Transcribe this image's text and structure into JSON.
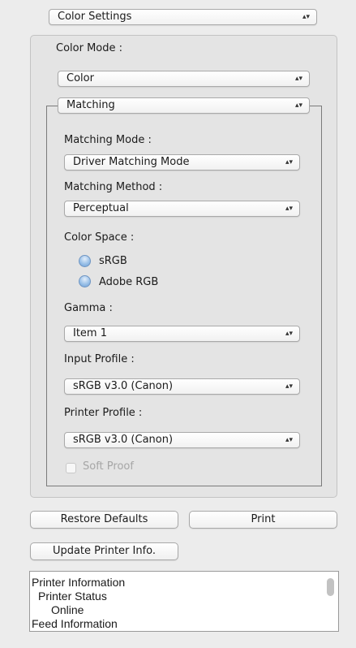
{
  "top_popup": {
    "value": "Color Settings"
  },
  "color_mode": {
    "label": "Color Mode :",
    "value": "Color"
  },
  "matching_group": {
    "header_value": "Matching",
    "matching_mode": {
      "label": "Matching Mode :",
      "value": "Driver Matching Mode"
    },
    "matching_method": {
      "label": "Matching Method :",
      "value": "Perceptual"
    },
    "color_space": {
      "label": "Color Space :",
      "options": [
        "sRGB",
        "Adobe RGB"
      ]
    },
    "gamma": {
      "label": "Gamma :",
      "value": "Item 1"
    },
    "input_profile": {
      "label": "Input Profile :",
      "value": "sRGB v3.0 (Canon)"
    },
    "printer_profile": {
      "label": "Printer Profile :",
      "value": "sRGB v3.0 (Canon)"
    },
    "soft_proof": {
      "label": "Soft Proof",
      "checked": false,
      "enabled": false
    }
  },
  "buttons": {
    "restore_defaults": "Restore Defaults",
    "print": "Print",
    "update_printer_info": "Update Printer Info."
  },
  "info_panel": {
    "lines": [
      "Printer Information",
      "Printer Status",
      "Online",
      "Feed Information"
    ]
  },
  "icons": {
    "popup_arrows": "⇕-updown-chevrons"
  }
}
